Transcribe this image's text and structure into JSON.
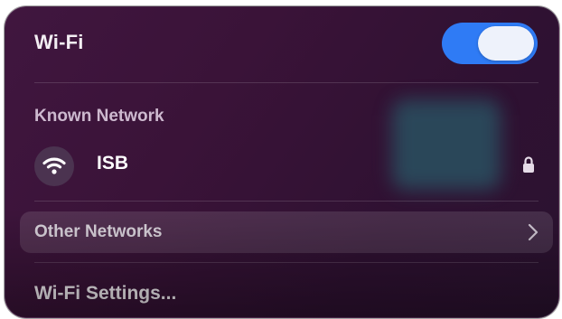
{
  "panel": {
    "title": "Wi-Fi",
    "wifi_enabled": true,
    "toggle_color": "#2f7bf5"
  },
  "known_networks": {
    "heading": "Known Network",
    "items": [
      {
        "name": "ISB",
        "icon": "wifi-signal-icon",
        "secured": true,
        "lock_icon": "lock-icon"
      }
    ]
  },
  "other_networks": {
    "label": "Other Networks",
    "icon": "chevron-right-icon"
  },
  "settings": {
    "label": "Wi-Fi Settings..."
  }
}
